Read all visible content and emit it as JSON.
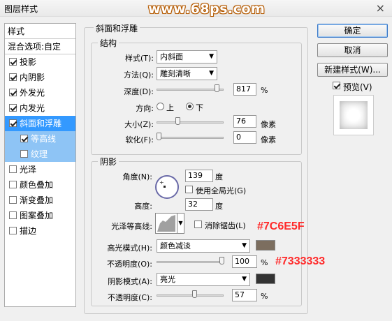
{
  "window": {
    "title": "图层样式",
    "watermark": "www.68ps.com",
    "close": "×"
  },
  "style_list": {
    "header": "样式",
    "blend": "混合选项:自定",
    "items": [
      {
        "label": "投影",
        "checked": true
      },
      {
        "label": "内阴影",
        "checked": true
      },
      {
        "label": "外发光",
        "checked": true
      },
      {
        "label": "内发光",
        "checked": true
      },
      {
        "label": "斜面和浮雕",
        "checked": true
      },
      {
        "label": "等高线",
        "checked": true
      },
      {
        "label": "纹理",
        "checked": false
      },
      {
        "label": "光泽",
        "checked": false
      },
      {
        "label": "颜色叠加",
        "checked": false
      },
      {
        "label": "渐变叠加",
        "checked": false
      },
      {
        "label": "图案叠加",
        "checked": false
      },
      {
        "label": "描边",
        "checked": false
      }
    ]
  },
  "bevel": {
    "group_title": "斜面和浮雕",
    "structure_title": "结构",
    "style_label": "样式(T):",
    "style_value": "内斜面",
    "technique_label": "方法(Q):",
    "technique_value": "雕刻清晰",
    "depth_label": "深度(D):",
    "depth_value": "817",
    "depth_unit": "%",
    "depth_slider": 0.93,
    "direction_label": "方向:",
    "direction_up": "上",
    "direction_down": "下",
    "size_label": "大小(Z):",
    "size_value": "76",
    "size_unit": "像素",
    "size_slider": 0.3,
    "soften_label": "软化(F):",
    "soften_value": "0",
    "soften_unit": "像素",
    "soften_slider": 0.0
  },
  "shading": {
    "title": "阴影",
    "angle_label": "角度(N):",
    "angle_value": "139",
    "angle_unit": "度",
    "global_light_label": "使用全局光(G)",
    "altitude_label": "高度:",
    "altitude_value": "32",
    "altitude_unit": "度",
    "gloss_label": "光泽等高线:",
    "antialias_label": "消除锯齿(L)",
    "highlight_mode_label": "高光模式(H):",
    "highlight_mode_value": "颜色减淡",
    "highlight_color": "#7C6E5F",
    "highlight_opacity_label": "不透明度(O):",
    "highlight_opacity_value": "100",
    "highlight_opacity_slider": 1.0,
    "shadow_mode_label": "阴影模式(A):",
    "shadow_mode_value": "亮光",
    "shadow_color": "#333333",
    "shadow_opacity_label": "不透明度(C):",
    "shadow_opacity_value": "57",
    "shadow_opacity_slider": 0.57,
    "percent": "%"
  },
  "buttons": {
    "ok": "确定",
    "cancel": "取消",
    "new_style": "新建样式(W)...",
    "preview": "预览(V)"
  },
  "annotations": {
    "highlight": "#7C6E5F",
    "shadow": "#7333333"
  }
}
